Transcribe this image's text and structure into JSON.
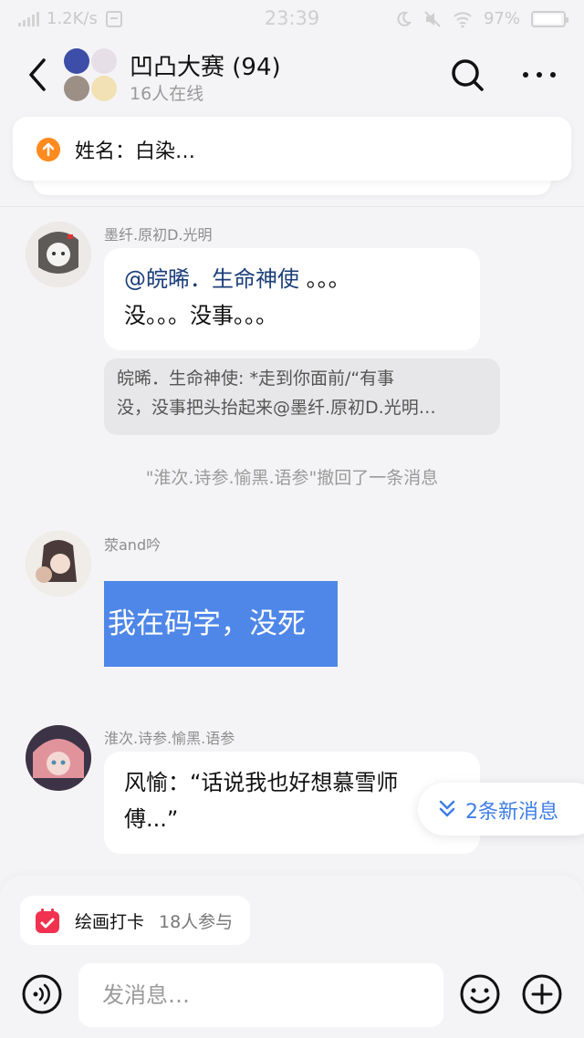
{
  "status_bar": {
    "net_speed": "1.2K/s",
    "time": "23:39",
    "battery": "97%",
    "battery_level": 0.97
  },
  "header": {
    "title": "凹凸大赛 (94)",
    "subtitle": "16人在线",
    "icons": {
      "back": "back-chevron-icon",
      "search": "search-icon",
      "more": "more-dots-icon"
    }
  },
  "pinned": {
    "text": "姓名：白染…",
    "icon": "upload-arrow-icon",
    "color": "#ff8a1e"
  },
  "messages": [
    {
      "sender": "墨纤.原初D.光明",
      "mention": "@皖晞．生命神使",
      "mention_tail": " 。。。",
      "line2": "没。。。没事。。。",
      "quote_line1": "皖晞．生命神使: *走到你面前/“有事",
      "quote_line2": "没，没事把头抬起来@墨纤.原初D.光明…"
    },
    {
      "system": "\"淮次.诗参.愉黑.语参\"撤回了一条消息"
    },
    {
      "sender": "荥and吟",
      "text": "我在码字，没死",
      "highlight_color": "#4f87e8"
    },
    {
      "sender": "淮次.诗参.愉黑.语参",
      "line1": "风愉：“话说我也好想慕雪师",
      "line2": "傅...”"
    }
  ],
  "new_messages": {
    "label": "2条新消息",
    "color": "#3e7ee6",
    "icon": "double-chevron-down-icon"
  },
  "bottom": {
    "checkin_label": "绘画打卡",
    "checkin_count": "18人参与",
    "checkin_icon": "calendar-icon",
    "input_placeholder": "发消息…",
    "icons": {
      "voice": "voice-icon",
      "emoji": "emoji-icon",
      "plus": "plus-icon"
    }
  }
}
